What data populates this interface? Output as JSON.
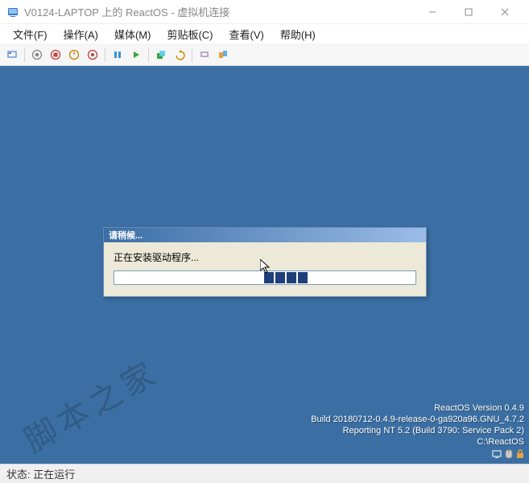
{
  "window": {
    "title": "V0124-LAPTOP 上的 ReactOS - 虚拟机连接"
  },
  "menu": {
    "file": "文件(F)",
    "action": "操作(A)",
    "media": "媒体(M)",
    "clipboard": "剪贴板(C)",
    "view": "查看(V)",
    "help": "帮助(H)"
  },
  "dialog": {
    "title": "请稍候...",
    "message": "正在安装驱动程序..."
  },
  "guest": {
    "version_line": "ReactOS Version 0.4.9",
    "build_line": "Build 20180712-0.4.9-release-0-ga920a96.GNU_4.7.2",
    "report_line": "Reporting NT 5.2 (Build 3790: Service Pack 2)",
    "path_line": "C:\\ReactOS"
  },
  "status": {
    "label": "状态:",
    "value": "正在运行"
  },
  "watermark": "脚本之家"
}
